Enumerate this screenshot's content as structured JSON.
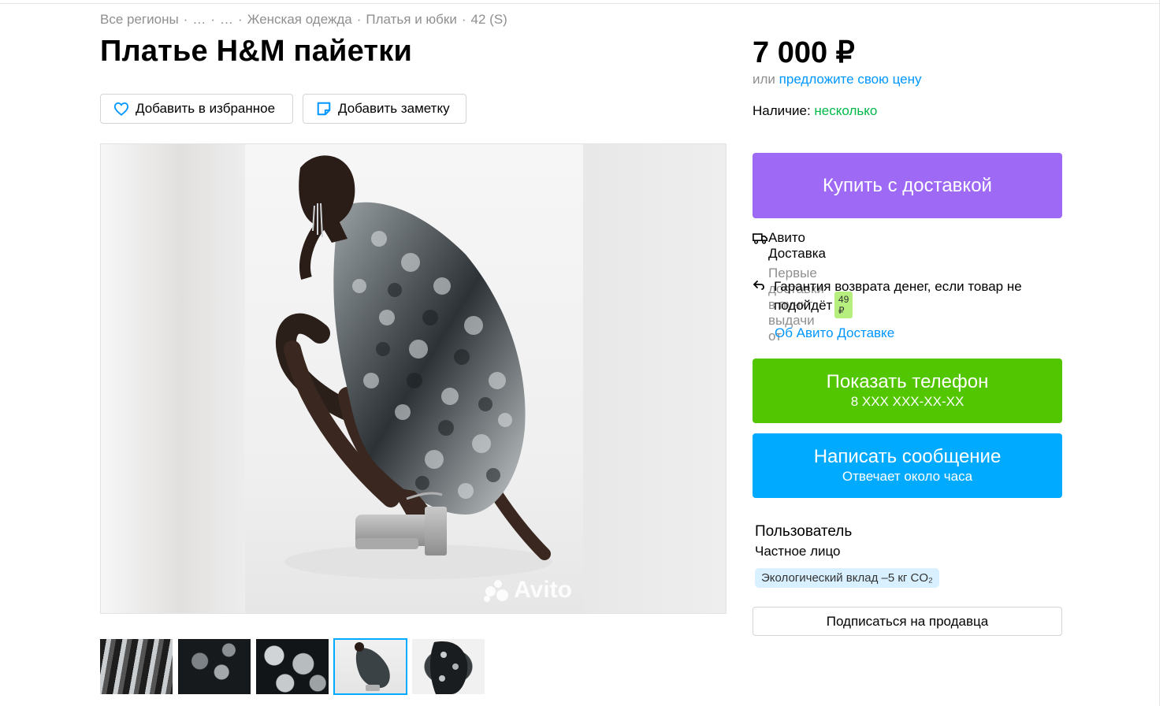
{
  "breadcrumb": {
    "items": [
      "Все регионы",
      "…",
      "…",
      "Женская одежда",
      "Платья и юбки",
      "42 (S)"
    ],
    "separator": "·"
  },
  "title": "Платье H&M пайетки",
  "actions": {
    "favorite_label": "Добавить в избранное",
    "note_label": "Добавить заметку"
  },
  "gallery": {
    "watermark": "Avito",
    "thumbnail_count": 5,
    "active_thumbnail": 4
  },
  "price": {
    "value": "7 000 ₽",
    "offer_prefix": "или",
    "offer_link": "предложите свою цену"
  },
  "availability": {
    "label": "Наличие:",
    "value": "несколько"
  },
  "buttons": {
    "buy": "Купить с доставкой",
    "phone_main": "Показать телефон",
    "phone_sub": "8 XXX XXX-XX-XX",
    "message_main": "Написать сообщение",
    "message_sub": "Отвечает около часа",
    "subscribe": "Подписаться на продавца"
  },
  "delivery": {
    "title": "Авито Доставка",
    "subtitle": "Первые доставки в пункт выдачи от",
    "price_badge": "49 ₽",
    "guarantee": "Гарантия возврата денег, если товар не подойдёт",
    "about_link": "Об Авито Доставке"
  },
  "seller": {
    "name": "Пользователь",
    "type": "Частное лицо",
    "eco_badge": "Экологический вклад –5 кг CO₂"
  },
  "colors": {
    "buy": "#9d69f5",
    "phone": "#52c600",
    "message": "#00aaff",
    "link": "#0096ff",
    "availability": "#00b84a",
    "badge_green": "#b6ef7e",
    "eco_badge": "#d8f0ff"
  }
}
